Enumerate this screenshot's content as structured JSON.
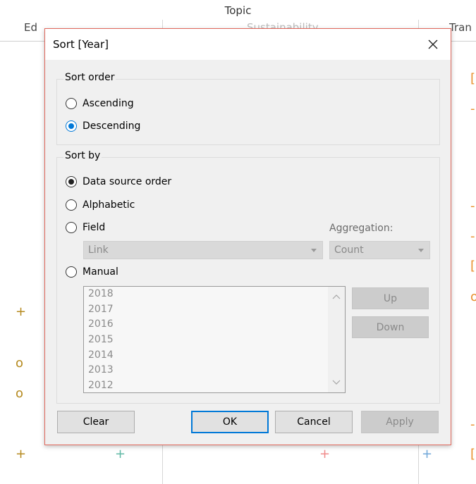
{
  "background": {
    "topic_label": "Topic",
    "columns": [
      "Ed",
      "Sustainability",
      "Tran"
    ],
    "marks_left": [
      "+",
      "o",
      "o",
      "+"
    ],
    "marks_bottom": [
      "+",
      "+",
      "+"
    ],
    "marks_right": [
      "[",
      "-",
      "-",
      "-",
      "[",
      "o",
      "-",
      "["
    ]
  },
  "dialog": {
    "title": "Sort [Year]",
    "close_icon": "close-icon",
    "sort_order": {
      "label": "Sort order",
      "options": [
        {
          "label": "Ascending",
          "selected": false
        },
        {
          "label": "Descending",
          "selected": true
        }
      ]
    },
    "sort_by": {
      "label": "Sort by",
      "options": [
        {
          "label": "Data source order",
          "selected": true
        },
        {
          "label": "Alphabetic",
          "selected": false
        },
        {
          "label": "Field",
          "selected": false
        },
        {
          "label": "Manual",
          "selected": false
        }
      ],
      "aggregation_label": "Aggregation:",
      "field_select": "Link",
      "aggregation_select": "Count",
      "manual_list": [
        "2018",
        "2017",
        "2016",
        "2015",
        "2014",
        "2013",
        "2012"
      ],
      "up_label": "Up",
      "down_label": "Down"
    },
    "buttons": {
      "clear": "Clear",
      "ok": "OK",
      "cancel": "Cancel",
      "apply": "Apply"
    }
  },
  "colors": {
    "accent": "#0078d7",
    "dialog_border": "#e0675c",
    "mark_olive": "#b58a1f",
    "mark_green": "#5fb8a5",
    "mark_red": "#f08a8a",
    "mark_blue": "#6ea6d8",
    "mark_orange": "#e8902c"
  }
}
